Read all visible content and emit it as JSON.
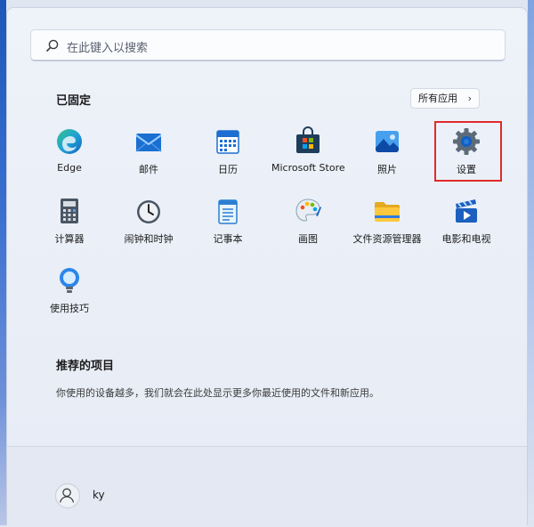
{
  "search": {
    "placeholder": "在此键入以搜索"
  },
  "pinned": {
    "title": "已固定",
    "all_apps_label": "所有应用",
    "apps": [
      {
        "label": "Edge",
        "icon": "edge-icon"
      },
      {
        "label": "邮件",
        "icon": "mail-icon"
      },
      {
        "label": "日历",
        "icon": "calendar-icon"
      },
      {
        "label": "Microsoft Store",
        "icon": "store-icon"
      },
      {
        "label": "照片",
        "icon": "photos-icon"
      },
      {
        "label": "设置",
        "icon": "settings-gear-icon"
      },
      {
        "label": "计算器",
        "icon": "calculator-icon"
      },
      {
        "label": "闹钟和时钟",
        "icon": "clock-icon"
      },
      {
        "label": "记事本",
        "icon": "notepad-icon"
      },
      {
        "label": "画图",
        "icon": "paint-icon"
      },
      {
        "label": "文件资源管理器",
        "icon": "folder-icon"
      },
      {
        "label": "电影和电视",
        "icon": "movies-icon"
      },
      {
        "label": "使用技巧",
        "icon": "tips-icon"
      }
    ]
  },
  "recommended": {
    "title": "推荐的项目",
    "text": "你使用的设备越多，我们就会在此处显示更多你最近使用的文件和新应用。"
  },
  "user": {
    "name": "ky"
  },
  "colors": {
    "highlight": "#e02a2a"
  }
}
